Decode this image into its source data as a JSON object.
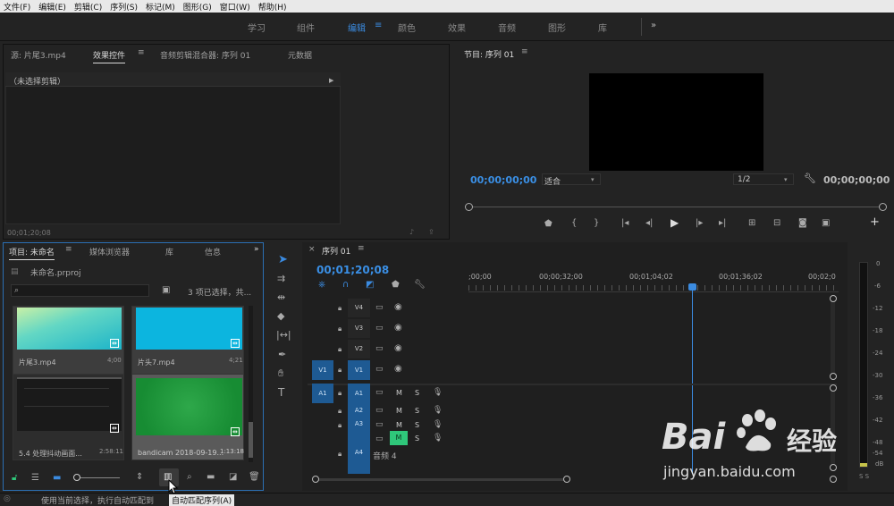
{
  "menu": [
    "文件(F)",
    "编辑(E)",
    "剪辑(C)",
    "序列(S)",
    "标记(M)",
    "图形(G)",
    "窗口(W)",
    "帮助(H)"
  ],
  "workspaces": [
    "学习",
    "组件",
    "编辑",
    "颜色",
    "效果",
    "音频",
    "图形",
    "库"
  ],
  "workspace_active": "编辑",
  "overflow": "»",
  "source_panel": {
    "tabs": [
      "源: 片尾3.mp4",
      "效果控件",
      "音频剪辑混合器: 序列 01",
      "元数据"
    ],
    "active_tab": "效果控件",
    "no_clip": "（未选择剪辑）",
    "timecode": "00;01;20;08"
  },
  "program": {
    "title": "节目: 序列 01",
    "timecode_left": "00;00;00;00",
    "fit": "适合",
    "resolution": "1/2",
    "timecode_right": "00;00;00;00"
  },
  "project": {
    "tabs": [
      "项目: 未命名",
      "媒体浏览器",
      "库",
      "信息"
    ],
    "file": "未命名.prproj",
    "selection_info": "3 项已选择，共...",
    "search_placeholder": "",
    "items": [
      {
        "name": "片尾3.mp4",
        "duration": "4;00"
      },
      {
        "name": "片头7.mp4",
        "duration": "4;21"
      },
      {
        "name": "5.4 处理抖动画面...",
        "duration": "2:58:11"
      },
      {
        "name": "bandicam 2018-09-19...",
        "duration": "1:13:18"
      }
    ]
  },
  "timeline": {
    "title": "序列 01",
    "timecode": "00;01;20;08",
    "ruler": [
      ";00;00",
      "00;00;32;00",
      "00;01;04;02",
      "00;01;36;02",
      "00;02;0"
    ],
    "video_tracks": [
      "V4",
      "V3",
      "V2",
      "V1"
    ],
    "audio_tracks": [
      "A1",
      "A2",
      "A3",
      "A4"
    ],
    "source_v": "V1",
    "source_a": "A1",
    "m": "M",
    "s": "S",
    "audio4_name": "音频 4"
  },
  "meter": {
    "scale": [
      "0",
      "-6",
      "-12",
      "-18",
      "-24",
      "-30",
      "-36",
      "-42",
      "-48",
      "-54",
      "dB"
    ],
    "bottom": "S S"
  },
  "status": {
    "text": "使用当前选择，执行自动匹配到",
    "tooltip": "自动匹配序列(A)"
  },
  "watermark": {
    "brand": "Bai",
    "brand2": "经验",
    "url": "jingyan.baidu.com"
  },
  "colors": {
    "accent": "#3b8be0",
    "track_blue": "#1e5a93",
    "mute_green": "#2fc77a"
  }
}
